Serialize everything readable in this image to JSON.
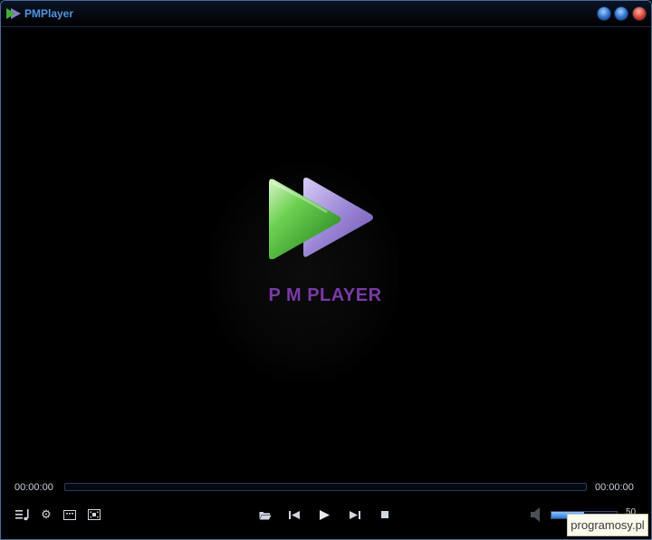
{
  "titlebar": {
    "title": "PMPlayer",
    "buttons": [
      "minimize-icon",
      "maximize-icon",
      "close-icon"
    ]
  },
  "logo": {
    "text": "P M PLAYER",
    "text_color": "#7a3aa8",
    "green": "#4fbf3a",
    "purple": "#9b86d6"
  },
  "playback": {
    "current_time": "00:00:00",
    "total_time": "00:00:00",
    "progress": 0
  },
  "controls": {
    "left": [
      "playlist-icon",
      "settings-icon",
      "subtitles-icon",
      "fullscreen-icon"
    ],
    "center": [
      "open-folder-icon",
      "previous-icon",
      "play-icon",
      "next-icon",
      "stop-icon"
    ]
  },
  "volume": {
    "value": "50",
    "level": 0.5
  },
  "watermark": {
    "text": "programosy.pl"
  },
  "colors": {
    "accent": "#4f95e0",
    "background": "#000000"
  }
}
